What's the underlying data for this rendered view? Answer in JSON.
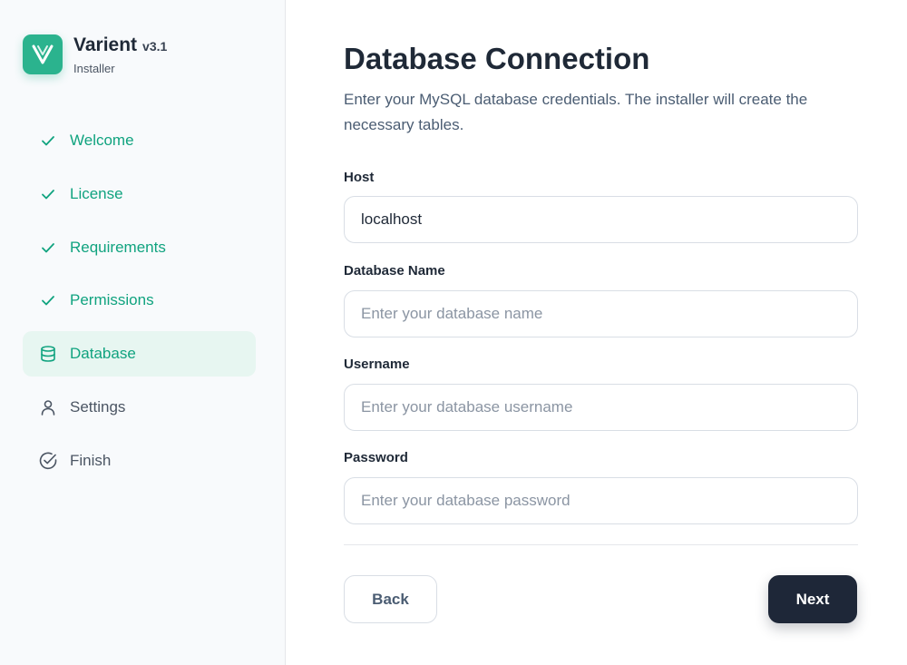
{
  "brand": {
    "name": "Varient",
    "version": "v3.1",
    "subtitle": "Installer",
    "logo_color": "#2bb38e"
  },
  "steps": [
    {
      "label": "Welcome",
      "state": "done",
      "icon": "check-icon"
    },
    {
      "label": "License",
      "state": "done",
      "icon": "check-icon"
    },
    {
      "label": "Requirements",
      "state": "done",
      "icon": "check-icon"
    },
    {
      "label": "Permissions",
      "state": "done",
      "icon": "check-icon"
    },
    {
      "label": "Database",
      "state": "active",
      "icon": "database-icon"
    },
    {
      "label": "Settings",
      "state": "todo",
      "icon": "user-icon"
    },
    {
      "label": "Finish",
      "state": "todo",
      "icon": "check-circle-icon"
    }
  ],
  "main": {
    "title": "Database Connection",
    "description": "Enter your MySQL database credentials. The installer will create the necessary tables."
  },
  "form": {
    "host": {
      "label": "Host",
      "value": "localhost",
      "placeholder": ""
    },
    "db_name": {
      "label": "Database Name",
      "value": "",
      "placeholder": "Enter your database name"
    },
    "username": {
      "label": "Username",
      "value": "",
      "placeholder": "Enter your database username"
    },
    "password": {
      "label": "Password",
      "value": "",
      "placeholder": "Enter your database password"
    }
  },
  "actions": {
    "back_label": "Back",
    "next_label": "Next"
  },
  "colors": {
    "accent": "#10a37f",
    "active_bg": "#e7f6f1",
    "primary_button": "#1e2738"
  }
}
